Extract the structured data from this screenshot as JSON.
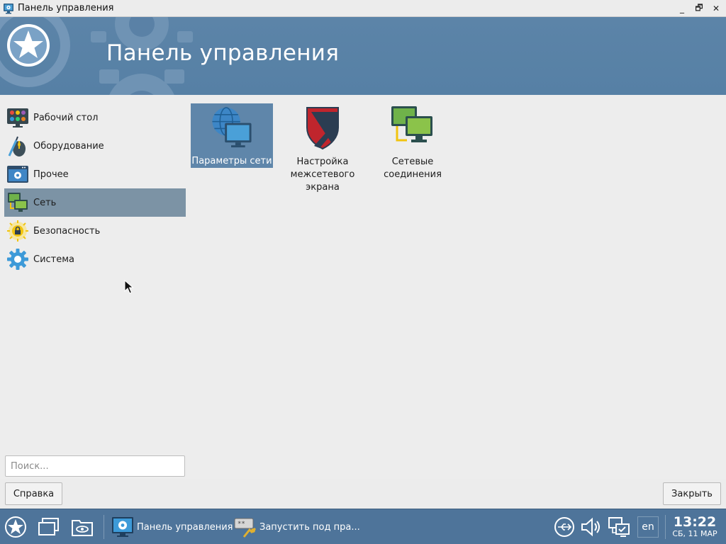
{
  "window": {
    "title": "Панель управления",
    "min_glyph": "_",
    "max_glyph": "🗗",
    "close_glyph": "✕"
  },
  "banner": {
    "title": "Панель управления"
  },
  "sidebar": {
    "items": [
      {
        "label": "Рабочий стол",
        "icon": "desktop-icon",
        "active": false
      },
      {
        "label": "Оборудование",
        "icon": "hardware-icon",
        "active": false
      },
      {
        "label": "Прочее",
        "icon": "other-icon",
        "active": false
      },
      {
        "label": "Сеть",
        "icon": "network-icon",
        "active": true
      },
      {
        "label": "Безопасность",
        "icon": "security-icon",
        "active": false
      },
      {
        "label": "Система",
        "icon": "system-gear-icon",
        "active": false
      }
    ]
  },
  "main": {
    "items": [
      {
        "label": "Параметры сети",
        "icon": "network-settings-icon",
        "selected": true
      },
      {
        "label": "Настройка межсетевого экрана",
        "icon": "firewall-shield-icon",
        "selected": false
      },
      {
        "label": "Сетевые соединения",
        "icon": "network-connections-icon",
        "selected": false
      }
    ]
  },
  "search": {
    "placeholder": "Поиск..."
  },
  "buttons": {
    "help": "Справка",
    "close": "Закрыть"
  },
  "taskbar": {
    "tasks": [
      {
        "label": "Панель управления",
        "icon": "control-panel-icon"
      },
      {
        "label": "Запустить под пра...",
        "icon": "run-as-icon"
      }
    ],
    "lang": "en",
    "time": "13:22",
    "date": "СБ, 11 МАР"
  },
  "colors": {
    "banner": "#5680a5",
    "selection": "#5f86aa",
    "sidebar_active": "#7c93a5",
    "taskbar": "#4e749a"
  }
}
